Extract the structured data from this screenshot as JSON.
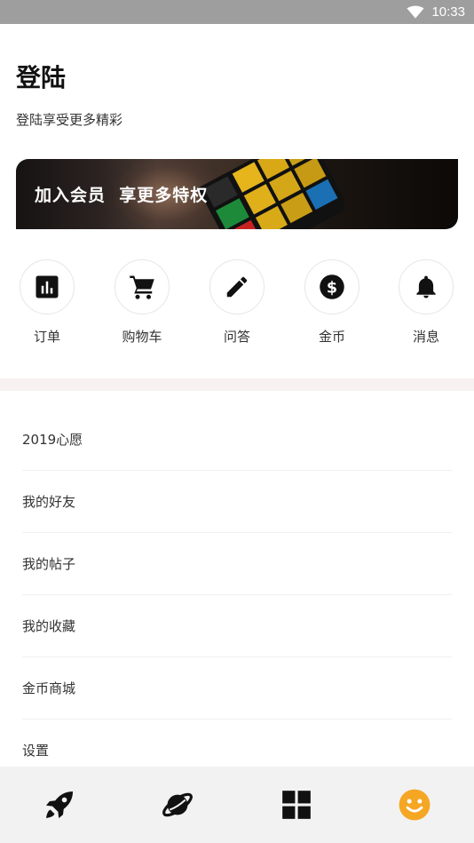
{
  "status_bar": {
    "time": "10:33",
    "wifi_icon": "wifi-icon"
  },
  "header": {
    "title": "登陆",
    "subtitle": "登陆享受更多精彩"
  },
  "vip_banner": {
    "text": "加入会员  享更多特权"
  },
  "quick_actions": [
    {
      "label": "订单",
      "icon": "bar-chart-icon"
    },
    {
      "label": "购物车",
      "icon": "cart-icon"
    },
    {
      "label": "问答",
      "icon": "pencil-icon"
    },
    {
      "label": "金币",
      "icon": "dollar-coin-icon"
    },
    {
      "label": "消息",
      "icon": "bell-icon"
    }
  ],
  "menu": [
    {
      "label": "2019心愿"
    },
    {
      "label": "我的好友"
    },
    {
      "label": "我的帖子"
    },
    {
      "label": "我的收藏"
    },
    {
      "label": "金币商城"
    },
    {
      "label": "设置"
    }
  ],
  "bottom_nav": [
    {
      "icon": "rocket-icon",
      "active": false
    },
    {
      "icon": "planet-icon",
      "active": false
    },
    {
      "icon": "grid-icon",
      "active": false
    },
    {
      "icon": "smiley-icon",
      "active": true
    }
  ],
  "colors": {
    "accent": "#f5a623",
    "status_bar": "#9e9e9e",
    "bottom_nav_bg": "#f2f2f2",
    "divider_band": "#f7f1f1"
  }
}
